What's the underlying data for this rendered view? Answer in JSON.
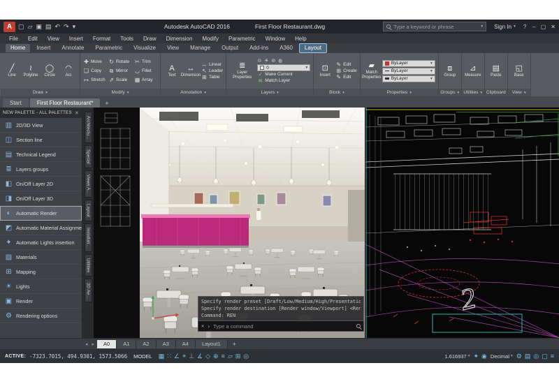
{
  "ui": {
    "caret": "▾",
    "close": "✕",
    "minimize": "–",
    "maximize": "▢",
    "help": "?",
    "prompt": "›"
  },
  "titlebar": {
    "logo_letter": "A",
    "app_title": "Autodesk AutoCAD 2016",
    "doc_title": "First Floor Restaurant.dwg",
    "search_placeholder": "Type a keyword or phrase",
    "signin_label": "Sign In",
    "qat_icons": [
      {
        "name": "new-file-icon",
        "glyph": "▢"
      },
      {
        "name": "open-file-icon",
        "glyph": "▱"
      },
      {
        "name": "save-icon",
        "glyph": "▣"
      },
      {
        "name": "plot-icon",
        "glyph": "▤"
      },
      {
        "name": "undo-icon",
        "glyph": "↶"
      },
      {
        "name": "redo-icon",
        "glyph": "↷"
      },
      {
        "name": "qat-dropdown-icon",
        "glyph": "▾"
      }
    ]
  },
  "menubar": {
    "items": [
      "File",
      "Edit",
      "View",
      "Insert",
      "Format",
      "Tools",
      "Draw",
      "Dimension",
      "Modify",
      "Parametric",
      "Window",
      "Help"
    ]
  },
  "ribbon": {
    "tabs": [
      {
        "label": "Home",
        "active": true
      },
      {
        "label": "Insert"
      },
      {
        "label": "Annotate"
      },
      {
        "label": "Parametric"
      },
      {
        "label": "Visualize"
      },
      {
        "label": "View"
      },
      {
        "label": "Manage"
      },
      {
        "label": "Output"
      },
      {
        "label": "Add-ins"
      },
      {
        "label": "A360"
      },
      {
        "label": "Layout",
        "highlighted": true
      }
    ],
    "panels": {
      "draw": {
        "label": "Draw",
        "buttons": [
          {
            "icon": "╱",
            "label": "Line"
          },
          {
            "icon": "≀",
            "label": "Polyline"
          },
          {
            "icon": "◯",
            "label": "Circle"
          },
          {
            "icon": "◠",
            "label": "Arc"
          }
        ]
      },
      "modify": {
        "label": "Modify",
        "buttons": [
          {
            "icon": "✚",
            "label": "Move"
          },
          {
            "icon": "↻",
            "label": "Rotate"
          },
          {
            "icon": "✂",
            "label": "Trim"
          },
          {
            "icon": "❏",
            "label": "Copy"
          },
          {
            "icon": "⧉",
            "label": "Mirror"
          },
          {
            "icon": "◡",
            "label": "Fillet"
          },
          {
            "icon": "↦",
            "label": "Stretch"
          },
          {
            "icon": "⇗",
            "label": "Scale"
          },
          {
            "icon": "▦",
            "label": "Array"
          }
        ]
      },
      "annotation": {
        "label": "Annotation",
        "big": [
          {
            "icon": "A",
            "label": "Text"
          },
          {
            "icon": "↔",
            "label": "Dimension"
          }
        ],
        "small": [
          {
            "icon": "↔",
            "label": "Linear"
          },
          {
            "icon": "↖",
            "label": "Leader"
          },
          {
            "icon": "⊞",
            "label": "Table"
          }
        ]
      },
      "layers": {
        "label": "Layers",
        "main_button": {
          "icon": "≣",
          "label": "Layer Properties"
        },
        "toggle_icons": [
          {
            "name": "layer-on-icon",
            "glyph": "⊙"
          },
          {
            "name": "layer-freeze-icon",
            "glyph": "☀"
          },
          {
            "name": "layer-lock-icon",
            "glyph": "⊘"
          },
          {
            "name": "layer-color-icon",
            "glyph": "◍"
          }
        ],
        "layer_combo_value": "0",
        "buttons": [
          {
            "icon": "✓",
            "label": "Make Current"
          },
          {
            "icon": "≋",
            "label": "Match Layer"
          }
        ]
      },
      "block": {
        "label": "Block",
        "main_button": {
          "icon": "⊡",
          "label": "Insert"
        },
        "buttons": [
          {
            "icon": "✎",
            "label": "Edit"
          },
          {
            "icon": "⊞",
            "label": "Create"
          },
          {
            "icon": "✎",
            "label": "Edit"
          }
        ]
      },
      "properties": {
        "label": "Properties",
        "main_button": {
          "icon": "▰",
          "label": "Match Properties"
        },
        "selects": [
          {
            "swatch": "color",
            "value": "ByLayer"
          },
          {
            "swatch": "linetype",
            "value": "ByLayer"
          },
          {
            "swatch": "lineweight",
            "value": "ByLayer"
          }
        ]
      },
      "groups": {
        "label": "Groups",
        "buttons": [
          {
            "icon": "⧈",
            "label": "Group"
          }
        ]
      },
      "utilities": {
        "label": "Utilities",
        "buttons": [
          {
            "icon": "⊿",
            "label": "Measure"
          }
        ]
      },
      "clipboard": {
        "label": "Clipboard",
        "buttons": [
          {
            "icon": "▤",
            "label": "Paste"
          }
        ]
      },
      "view": {
        "label": "View",
        "buttons": [
          {
            "icon": "◱",
            "label": "Base"
          }
        ]
      }
    }
  },
  "doc_tabs": {
    "tabs": [
      {
        "label": "Start"
      },
      {
        "label": "First Floor Restaurant*",
        "active": true
      }
    ],
    "new_tab_label": "+"
  },
  "palette": {
    "title": "NEW PALETTE - ALL PALETTES",
    "items": [
      {
        "icon": "▥",
        "label": "2D/3D View"
      },
      {
        "icon": "◫",
        "label": "Section line"
      },
      {
        "icon": "▤",
        "label": "Technical Legend"
      },
      {
        "icon": "≣",
        "label": "Layers groups"
      },
      {
        "icon": "◧",
        "label": "On/Off Layer 2D"
      },
      {
        "icon": "◨",
        "label": "On/Off Layer 3D"
      },
      {
        "icon": "◐",
        "label": "Automatic Render",
        "active": true
      },
      {
        "icon": "◩",
        "label": "Automatic Material Assignment"
      },
      {
        "icon": "✦",
        "label": "Automatic Lights insertion"
      },
      {
        "icon": "▨",
        "label": "Materials"
      },
      {
        "icon": "⊞",
        "label": "Mapping"
      },
      {
        "icon": "☀",
        "label": "Lights"
      },
      {
        "icon": "▣",
        "label": "Render"
      },
      {
        "icon": "⚙",
        "label": "Rendering options"
      }
    ]
  },
  "side_tabs": [
    "Architectu...",
    "Special",
    "Views A...",
    "Layout",
    "Installati...",
    "Utilities",
    "3D Ae..."
  ],
  "command": {
    "history": [
      "Specify render preset [Draft/Low/Medium/High/Presentation/Other] <Medium>:",
      "Specify render destination [Render window/Viewport] <Render window>:",
      "Command: REN"
    ],
    "placeholder": "Type a command"
  },
  "viewports": {
    "right": {
      "floor_label": "2"
    }
  },
  "layout_bar": {
    "nav_prev": "◂",
    "nav_next": "▸",
    "tabs": [
      {
        "label": "A0",
        "active": true
      },
      {
        "label": "A1"
      },
      {
        "label": "A2"
      },
      {
        "label": "A3"
      },
      {
        "label": "A4"
      },
      {
        "label": "Layout1"
      }
    ],
    "add_label": "+"
  },
  "statusbar": {
    "active_label": "ACTIVE:",
    "coordinates": "-7323.7015, 494.9301, 1573.5066",
    "model_label": "MODEL",
    "left_icons": [
      {
        "name": "grid-icon",
        "glyph": "▦"
      },
      {
        "name": "snap-icon",
        "glyph": "∷"
      },
      {
        "name": "infer-constraints-icon",
        "glyph": "∠"
      },
      {
        "name": "dynamic-input-icon",
        "glyph": "⌖"
      },
      {
        "name": "ortho-icon",
        "glyph": "⊥"
      },
      {
        "name": "polar-tracking-icon",
        "glyph": "∡"
      },
      {
        "name": "isodraft-icon",
        "glyph": "◇"
      },
      {
        "name": "osnap-icon",
        "glyph": "⊕"
      },
      {
        "name": "lineweight-icon",
        "glyph": "≡"
      },
      {
        "name": "transparency-icon",
        "glyph": "▱"
      },
      {
        "name": "selection-cycling-icon",
        "glyph": "⊞"
      },
      {
        "name": "annotation-monitor-icon",
        "glyph": "◎"
      }
    ],
    "annotation_scale": "1.616937",
    "units": "Decimal",
    "right_icons_a": [
      {
        "name": "annotation-visibility-icon",
        "glyph": "✦"
      },
      {
        "name": "autoscale-icon",
        "glyph": "◉"
      }
    ],
    "right_icons_b": [
      {
        "name": "workspace-gear-icon",
        "glyph": "⚙"
      },
      {
        "name": "quick-properties-icon",
        "glyph": "▤"
      },
      {
        "name": "isolate-objects-icon",
        "glyph": "◎"
      },
      {
        "name": "clean-screen-icon",
        "glyph": "▢"
      },
      {
        "name": "customization-icon",
        "glyph": "≡"
      }
    ]
  }
}
